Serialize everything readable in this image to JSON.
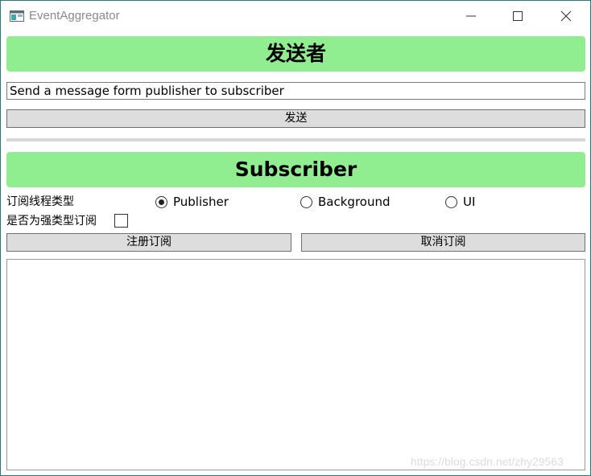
{
  "window": {
    "title": "EventAggregator",
    "icon": "app-window-icon",
    "controls": [
      "minimize-icon",
      "maximize-icon",
      "close-icon"
    ]
  },
  "publisher": {
    "header": "发送者",
    "message_input_value": "Send a message form publisher to subscriber",
    "send_button_label": "发送"
  },
  "subscriber": {
    "header": "Subscriber",
    "thread_type_label": "订阅线程类型",
    "thread_options": [
      {
        "label": "Publisher",
        "selected": true
      },
      {
        "label": "Background",
        "selected": false
      },
      {
        "label": "UI",
        "selected": false
      }
    ],
    "strong_ref_label": "是否为强类型订阅",
    "strong_ref_checked": false,
    "register_button_label": "注册订阅",
    "unregister_button_label": "取消订阅",
    "received_messages": []
  },
  "watermark": "https://blog.csdn.net/zhy29563",
  "colors": {
    "banner": "#90ee90",
    "button_bg": "#dddddd",
    "title_text": "#8a8a8a"
  }
}
